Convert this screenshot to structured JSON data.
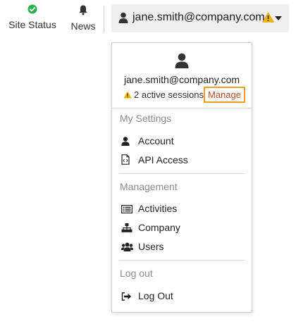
{
  "topbar": {
    "site_status": "Site Status",
    "news": "News",
    "user_email": "jane.smith@company.com"
  },
  "dropdown": {
    "email": "jane.smith@company.com",
    "sessions": "2 active sessions",
    "manage": "Manage",
    "sections": {
      "my_settings": "My Settings",
      "management": "Management",
      "log_out": "Log out"
    },
    "items": {
      "account": "Account",
      "api_access": "API Access",
      "activities": "Activities",
      "company": "Company",
      "users": "Users",
      "logout": "Log Out"
    }
  },
  "colors": {
    "status_ok": "#2fae4f",
    "warning": "#f0b400",
    "manage_text": "#b44a2a",
    "highlight_border": "#f0a020"
  }
}
